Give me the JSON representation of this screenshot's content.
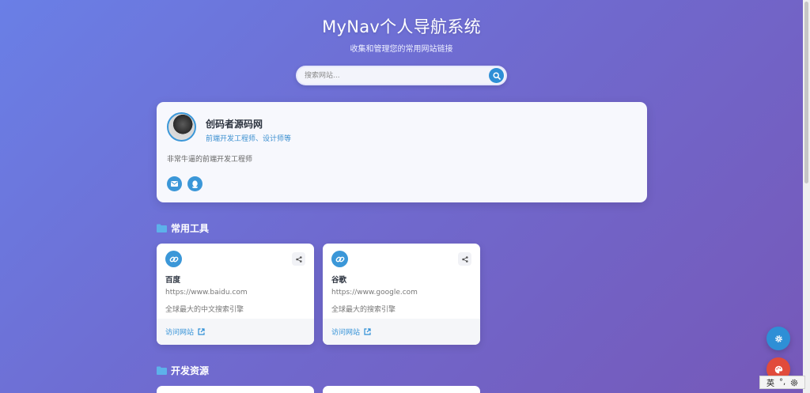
{
  "header": {
    "title": "MyNav个人导航系统",
    "subtitle": "收集和管理您的常用网站链接"
  },
  "search": {
    "placeholder": "搜索网站..."
  },
  "profile": {
    "name": "创码者源码网",
    "role": "前端开发工程师、设计师等",
    "description": "非常牛逼的前端开发工程师"
  },
  "sections": [
    {
      "title": "常用工具",
      "cards": [
        {
          "name": "百度",
          "url": "https://www.baidu.com",
          "desc": "全球最大的中文搜索引擎",
          "visit": "访问网站"
        },
        {
          "name": "谷歌",
          "url": "https://www.google.com",
          "desc": "全球最大的搜索引擎",
          "visit": "访问网站"
        }
      ]
    },
    {
      "title": "开发资源"
    }
  ],
  "ime": {
    "label": "英",
    "punct": "°,"
  },
  "colors": {
    "accent": "#3b97d8",
    "gradient_start": "#6a7fe6",
    "gradient_end": "#7658b8",
    "fab_settings": "#2e8fd6",
    "fab_theme": "#e14b3b"
  }
}
